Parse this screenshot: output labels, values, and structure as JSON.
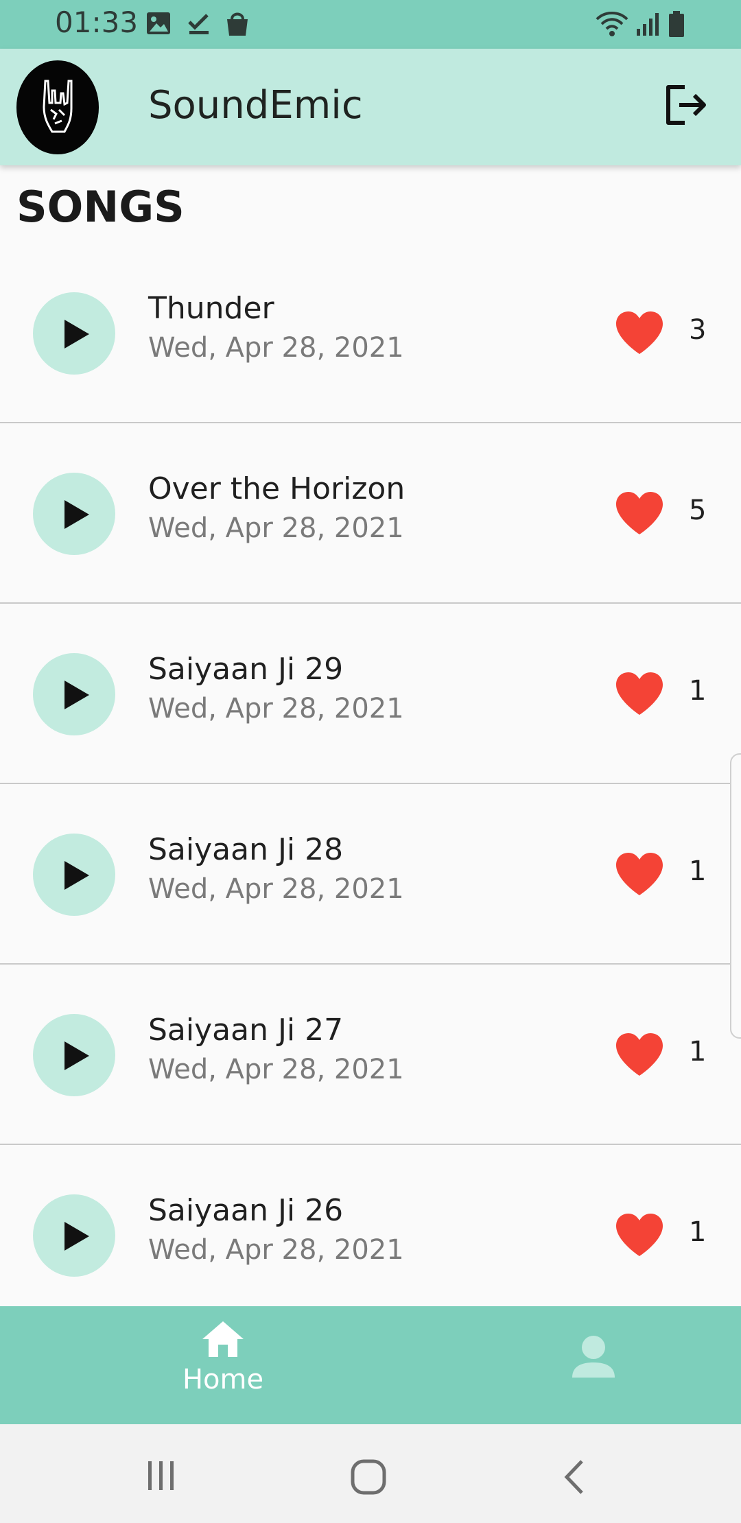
{
  "status_bar": {
    "time": "01:33",
    "left_icons": [
      "image-icon",
      "check-icon",
      "shopping-bag-icon"
    ],
    "right_icons": [
      "wifi-icon",
      "signal-icon",
      "battery-icon"
    ],
    "background": "#7dcfbb"
  },
  "app_bar": {
    "title": "SoundEmic",
    "logo_icon": "rock-hand-icon",
    "logout_icon": "logout-icon",
    "background": "#c0eadf"
  },
  "section": {
    "title": "SONGS"
  },
  "songs": [
    {
      "title": "Thunder",
      "date": "Wed, Apr 28, 2021",
      "likes": "3"
    },
    {
      "title": "Over the Horizon",
      "date": "Wed, Apr 28, 2021",
      "likes": "5"
    },
    {
      "title": "Saiyaan Ji 29",
      "date": "Wed, Apr 28, 2021",
      "likes": "1"
    },
    {
      "title": "Saiyaan Ji 28",
      "date": "Wed, Apr 28, 2021",
      "likes": "1"
    },
    {
      "title": "Saiyaan Ji 27",
      "date": "Wed, Apr 28, 2021",
      "likes": "1"
    },
    {
      "title": "Saiyaan Ji 26",
      "date": "Wed, Apr 28, 2021",
      "likes": "1"
    }
  ],
  "colors": {
    "accent": "#7dcfbb",
    "play_bg": "#c2ebdf",
    "heart": "#f44336"
  },
  "bottom_nav": {
    "home_label": "Home",
    "home_icon": "home-icon",
    "profile_icon": "person-icon"
  },
  "system_nav": {
    "icons": [
      "recent-apps-icon",
      "home-circle-icon",
      "back-icon"
    ]
  }
}
